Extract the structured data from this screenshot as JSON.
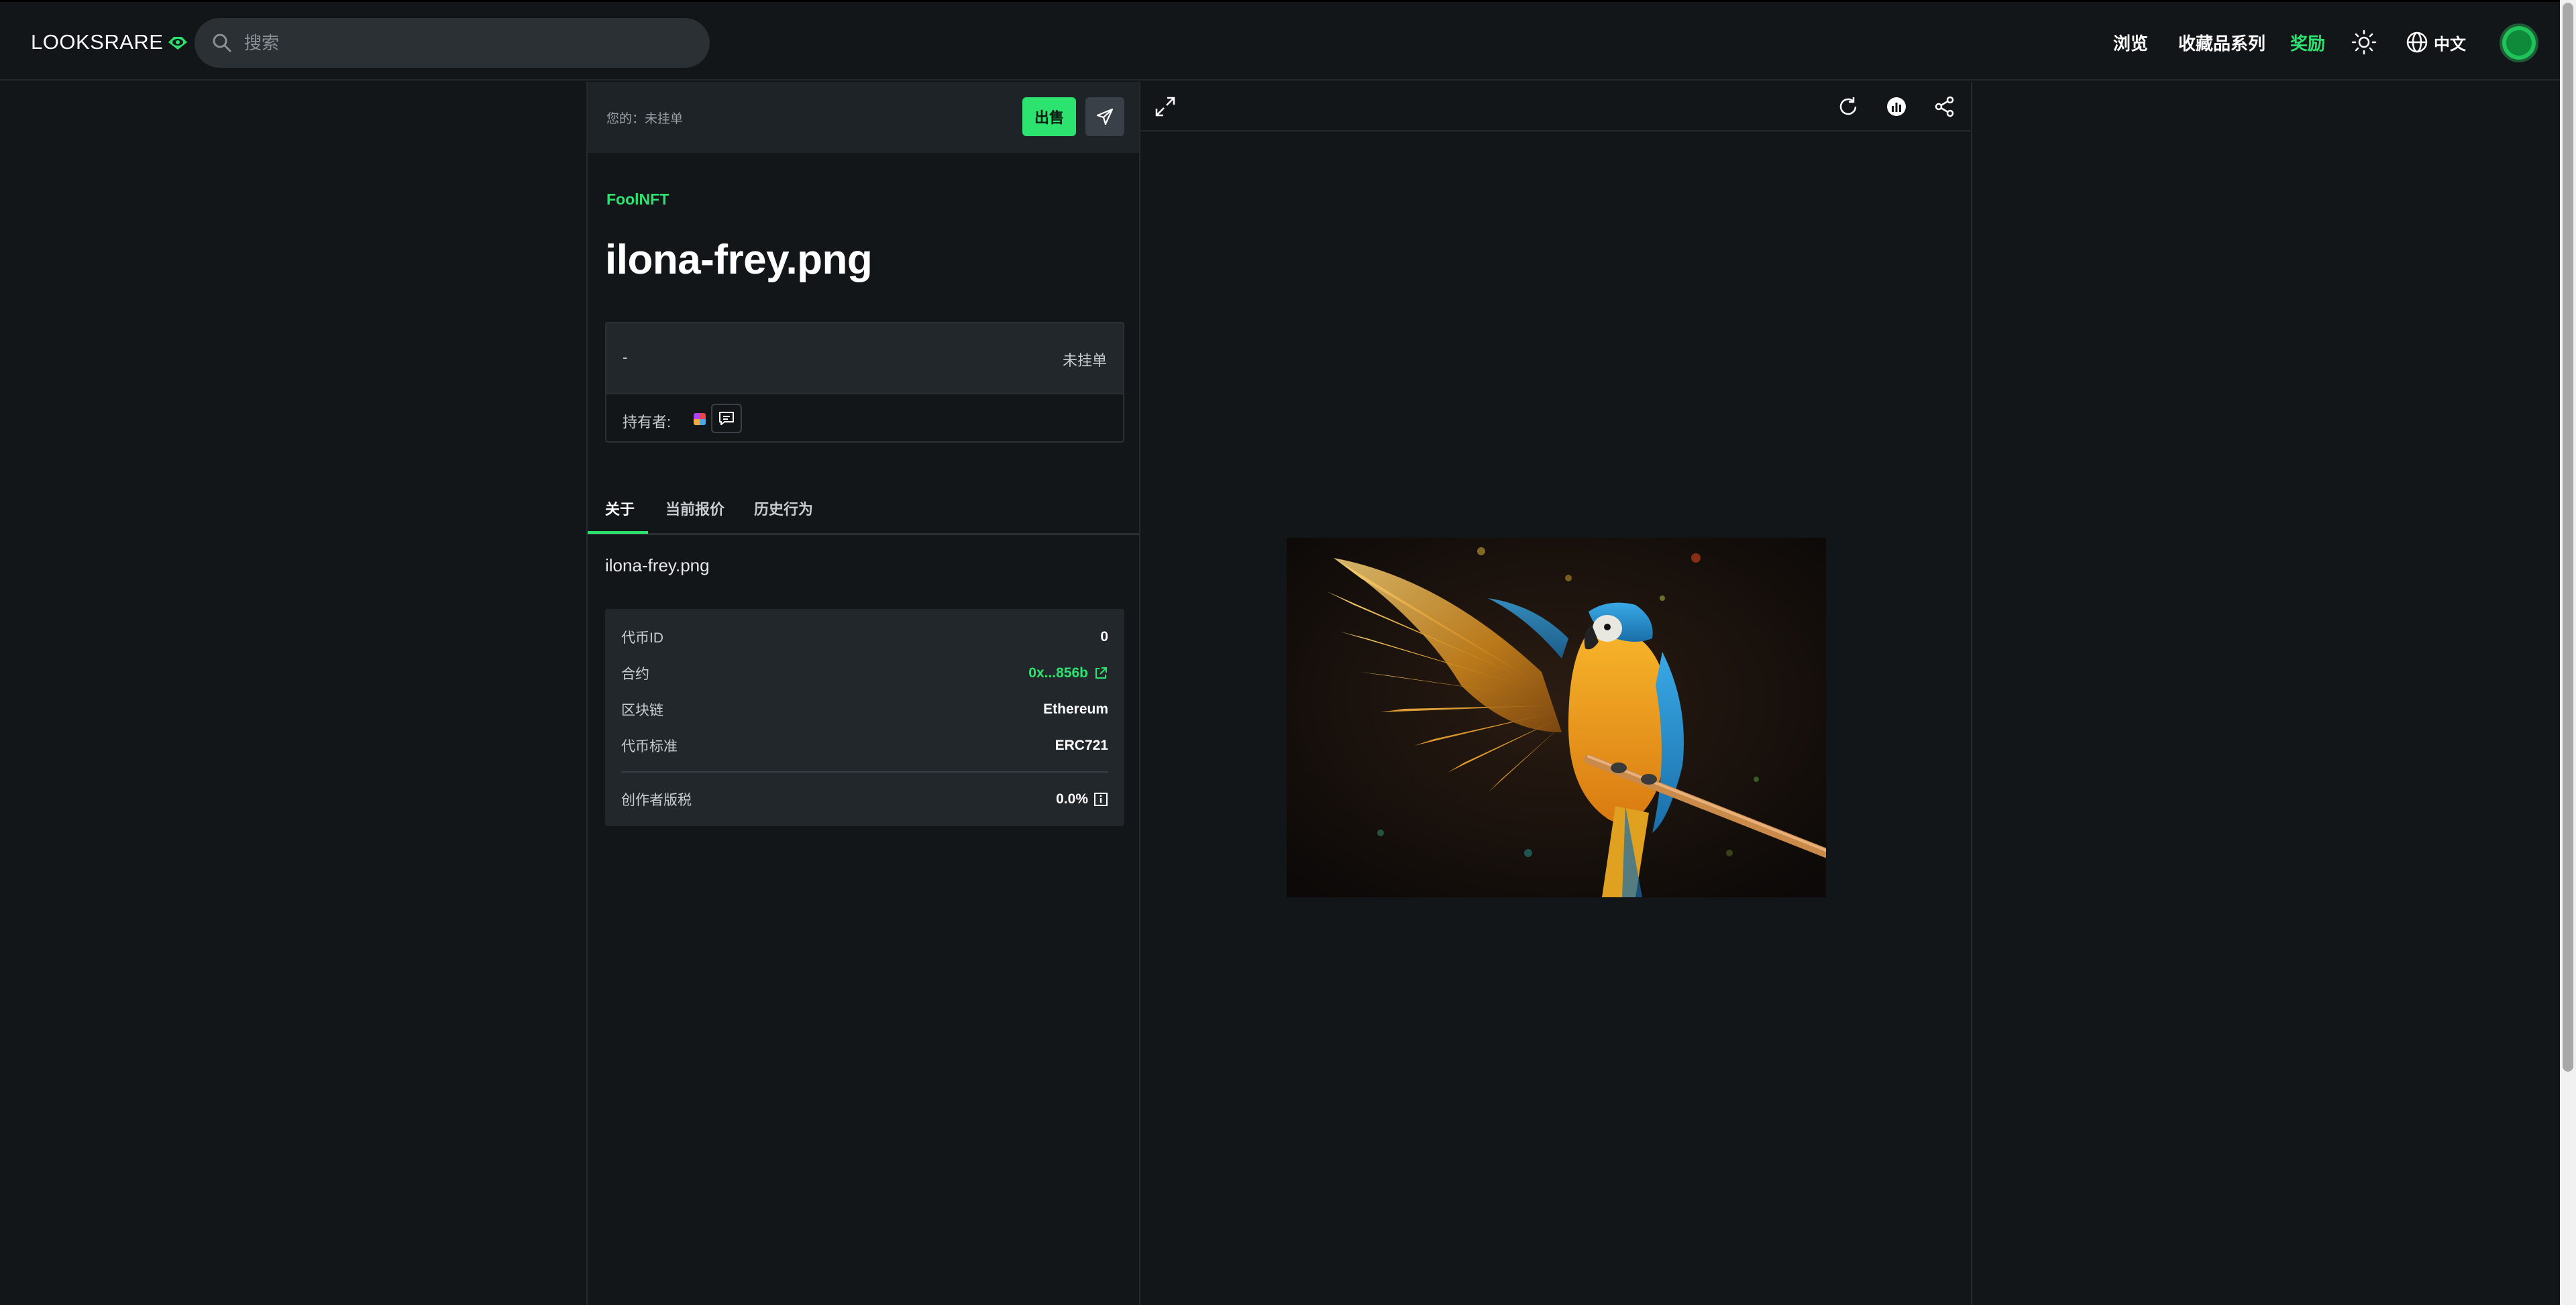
{
  "header": {
    "logo_text": "LOOKSRARE",
    "search_placeholder": "搜索",
    "nav": {
      "browse": "浏览",
      "collections": "收藏品系列",
      "rewards": "奖励"
    },
    "language": "中文"
  },
  "owner_bar": {
    "status": "您的：未挂单",
    "sell_label": "出售"
  },
  "item": {
    "collection": "FoolNFT",
    "title": "ilona-frey.png",
    "price": "-",
    "listing_status": "未挂单",
    "holder_label": "持有者:",
    "description": "ilona-frey.png"
  },
  "tabs": {
    "about": "关于",
    "offers": "当前报价",
    "history": "历史行为"
  },
  "details": {
    "token_id_label": "代币ID",
    "token_id": "0",
    "contract_label": "合约",
    "contract": "0x...856b",
    "chain_label": "区块链",
    "chain": "Ethereum",
    "standard_label": "代币标准",
    "standard": "ERC721",
    "royalty_label": "创作者版税",
    "royalty": "0.0%"
  },
  "colors": {
    "accent": "#2de370",
    "background": "#121619",
    "panel": "#22272c"
  },
  "icons": [
    "search-icon",
    "eye-logo-icon",
    "sun-icon",
    "globe-icon",
    "send-icon",
    "chat-icon",
    "external-link-icon",
    "info-icon",
    "expand-icon",
    "refresh-icon",
    "chart-icon",
    "share-icon"
  ]
}
